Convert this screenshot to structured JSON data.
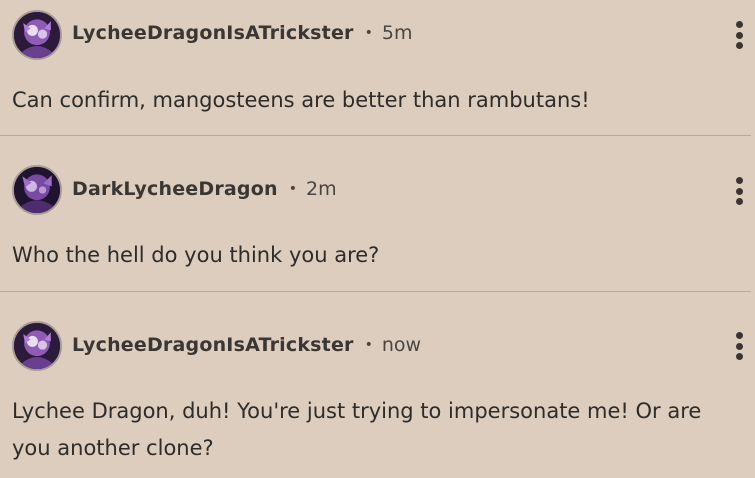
{
  "comments": [
    {
      "username": "LycheeDragonIsATrickster",
      "separator": "•",
      "time": "5m",
      "text": "Can confirm, mangosteens are better than rambutans!",
      "avatar_icon": "avatar-dragon-icon",
      "menu_icon": "more-vertical-icon"
    },
    {
      "username": "DarkLycheeDragon",
      "separator": "•",
      "time": "2m",
      "text": "Who the hell do you think you are?",
      "avatar_icon": "avatar-dark-dragon-icon",
      "menu_icon": "more-vertical-icon"
    },
    {
      "username": "LycheeDragonIsATrickster",
      "separator": "•",
      "time": "now",
      "text": "Lychee Dragon, duh! You're just trying to impersonate me! Or are you another clone?",
      "avatar_icon": "avatar-dragon-icon",
      "menu_icon": "more-vertical-icon"
    }
  ],
  "colors": {
    "background": "#dccdbf",
    "divider": "#b8aa9d",
    "text": "#2f2b28",
    "avatar_accent": "#8e5bb5"
  }
}
